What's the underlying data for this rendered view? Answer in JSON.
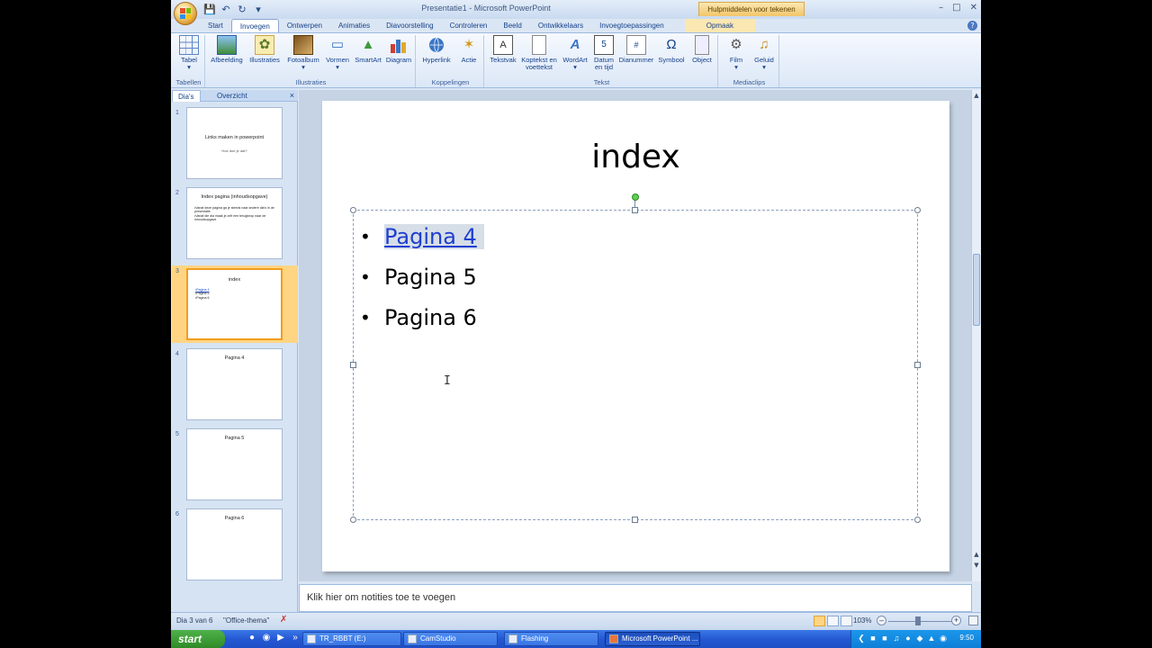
{
  "window": {
    "title": "Presentatie1 - Microsoft PowerPoint",
    "context_tools": "Hulpmiddelen voor tekenen",
    "controls": [
      "–",
      "□",
      "✕"
    ]
  },
  "qat": [
    "save-icon",
    "undo-icon",
    "redo-icon",
    "customize-icon"
  ],
  "tabs": [
    "Start",
    "Invoegen",
    "Ontwerpen",
    "Animaties",
    "Diavoorstelling",
    "Controleren",
    "Beeld",
    "Ontwikkelaars",
    "Invoegtoepassingen"
  ],
  "context_tab": "Opmaak",
  "ribbon": {
    "groups": [
      {
        "label": "Tabellen",
        "buttons": [
          {
            "label": "Tabel",
            "icon": "table-icon"
          }
        ]
      },
      {
        "label": "Illustraties",
        "buttons": [
          {
            "label": "Afbeelding",
            "icon": "picture-icon"
          },
          {
            "label": "Illustraties",
            "icon": "clipart-icon"
          },
          {
            "label": "Fotoalbum",
            "icon": "photo-album-icon"
          },
          {
            "label": "Vormen",
            "icon": "shapes-icon"
          },
          {
            "label": "SmartArt",
            "icon": "smartart-icon"
          },
          {
            "label": "Diagram",
            "icon": "chart-icon"
          }
        ]
      },
      {
        "label": "Koppelingen",
        "buttons": [
          {
            "label": "Hyperlink",
            "icon": "hyperlink-icon"
          },
          {
            "label": "Actie",
            "icon": "action-icon"
          }
        ]
      },
      {
        "label": "Tekst",
        "buttons": [
          {
            "label": "Tekstvak",
            "icon": "textbox-icon"
          },
          {
            "label": "Koptekst en voettekst",
            "icon": "header-footer-icon"
          },
          {
            "label": "WordArt",
            "icon": "wordart-icon"
          },
          {
            "label": "Datum en tijd",
            "icon": "date-time-icon"
          },
          {
            "label": "Dianummer",
            "icon": "slide-number-icon"
          },
          {
            "label": "Symbool",
            "icon": "symbol-icon"
          },
          {
            "label": "Object",
            "icon": "object-icon"
          }
        ]
      },
      {
        "label": "Mediaclips",
        "buttons": [
          {
            "label": "Film",
            "icon": "movie-icon"
          },
          {
            "label": "Geluid",
            "icon": "sound-icon"
          }
        ]
      }
    ]
  },
  "panel": {
    "tabs": [
      "Dia's",
      "Overzicht"
    ],
    "close": "×"
  },
  "thumbnails": [
    {
      "num": "1",
      "title": "Links maken in powerpoint",
      "subtitle": "Hoe doe je dat?"
    },
    {
      "num": "2",
      "title": "Index pagina (inhoudsopgave)",
      "bullets": [
        "Vanaf deze pagina ga je steeds naar andere dia's in de presentatie",
        "Vanaf die dia maak je zelf een terugknop naar de inhoudsopgave"
      ]
    },
    {
      "num": "3",
      "title": "index",
      "bullets": [
        "Pagina 4",
        "Pagina 5",
        "Pagina 6"
      ]
    },
    {
      "num": "4",
      "title": "Pagina 4"
    },
    {
      "num": "5",
      "title": "Pagina 5"
    },
    {
      "num": "6",
      "title": "Pagina 6"
    }
  ],
  "slide": {
    "title": "index",
    "bullets": [
      "Pagina 4",
      "Pagina 5",
      "Pagina 6"
    ]
  },
  "notes_placeholder": "Klik hier om notities toe te voegen",
  "status": {
    "slide_info": "Dia 3 van 6",
    "theme": "\"Office-thema\"",
    "zoom": "103%"
  },
  "taskbar": {
    "start": "start",
    "tasks": [
      "TR_RBBT (E:)",
      "CamStudio",
      "Flashing",
      "Microsoft PowerPoint ..."
    ],
    "clock": "9:50"
  },
  "colors": {
    "hyperlink": "#1f3fd0",
    "selection": "#ffd583",
    "ribbon": "#dbe7f7"
  }
}
